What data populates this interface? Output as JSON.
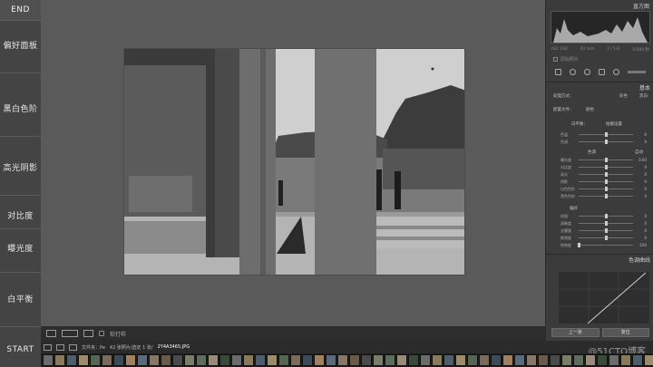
{
  "left_menu": {
    "end_label": "END",
    "items": [
      "偏好面板",
      "黑白色阶",
      "高光阴影",
      "对比度",
      "曝光度",
      "白平衡"
    ],
    "start_label": "START"
  },
  "toolbar": {
    "softproof_label": "软打样"
  },
  "right_panel": {
    "histogram_title": "直方图",
    "histogram_caption": [
      "ISO 100",
      "42 mm",
      "f / 5.6",
      "1/500 秒"
    ],
    "original_label": "原始照片",
    "basic_title": "基本",
    "treatment_label": "处理方式：",
    "treatment_color": "彩色",
    "treatment_bw": "黑白",
    "profile_label": "配置文件：",
    "profile_value": "颜色",
    "wb_label": "白平衡：",
    "wb_value": "拍摄设置",
    "tone_label": "色调",
    "tone_auto": "自动",
    "presence_label": "偏好",
    "wb_sliders": [
      {
        "label": "色温",
        "value": "0"
      },
      {
        "label": "色调",
        "value": "0"
      }
    ],
    "tone_sliders": [
      {
        "label": "曝光度",
        "value": "0.00"
      },
      {
        "label": "对比度",
        "value": "0"
      },
      {
        "label": "高光",
        "value": "0"
      },
      {
        "label": "阴影",
        "value": "0"
      },
      {
        "label": "白色色阶",
        "value": "0"
      },
      {
        "label": "黑色色阶",
        "value": "0"
      }
    ],
    "presence_sliders": [
      {
        "label": "纹理",
        "value": "0"
      },
      {
        "label": "清晰度",
        "value": "0"
      },
      {
        "label": "去朦胧",
        "value": "0"
      },
      {
        "label": "鲜艳度",
        "value": "0"
      },
      {
        "label": "饱和度",
        "value": "-100"
      }
    ],
    "curve_title": "色调曲线",
    "prev_button": "上一张",
    "reset_button": "复位"
  },
  "filmbar": {
    "prefix": "文件夹：Pe",
    "info": "42 张照片/选定 1 张/",
    "filename": "2Y4A3465.JPG"
  },
  "watermark": "@51CTO博客",
  "colors": {
    "accent": "#d9d9d9",
    "panel_bg": "#3b3b3b",
    "canvas_bg": "#5a5a5a"
  }
}
